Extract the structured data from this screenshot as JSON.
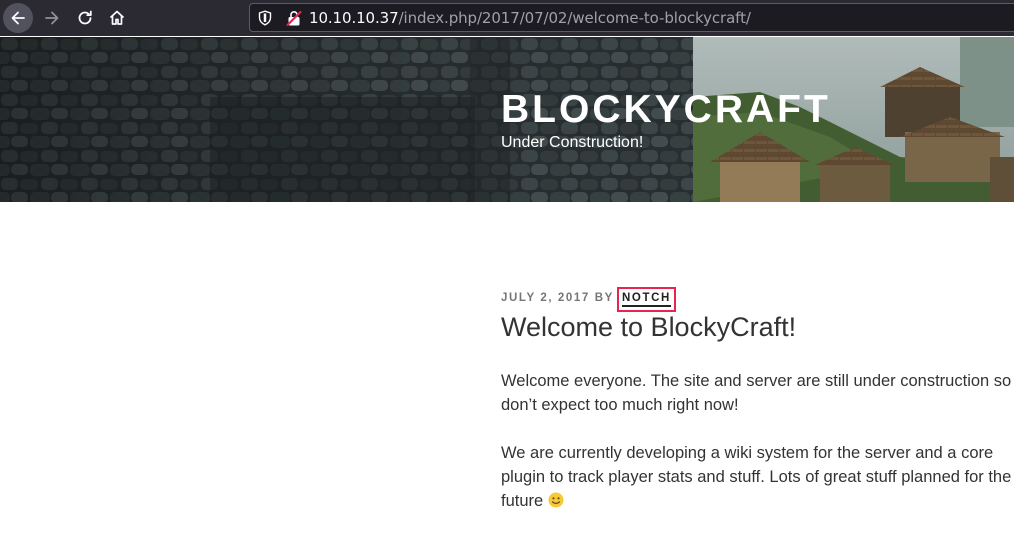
{
  "browser": {
    "url_host": "10.10.10.37",
    "url_path": "/index.php/2017/07/02/welcome-to-blockycraft/",
    "icons": [
      "back-icon",
      "forward-icon",
      "reload-icon",
      "home-icon",
      "tracking-shield-icon",
      "insecure-lock-icon"
    ]
  },
  "header": {
    "site_title": "BLOCKYCRAFT",
    "site_description": "Under Construction!"
  },
  "post": {
    "date": "July 2, 2017",
    "by_label": "by",
    "author": "Notch",
    "title": "Welcome to BlockyCraft!",
    "paragraphs": [
      "Welcome everyone. The site and server are still under construction so don’t expect too much right now!",
      "We are currently developing a wiki system for the server and a core plugin to track player stats and stuff. Lots of great stuff planned for the future"
    ],
    "emoji": "slightly-smiling-face-icon"
  },
  "colors": {
    "toolbar_bg": "#2b2a33",
    "urlbar_bg": "#1c1b22",
    "highlight_box": "#e8254e",
    "text": "#333333",
    "meta_text": "#767676"
  }
}
